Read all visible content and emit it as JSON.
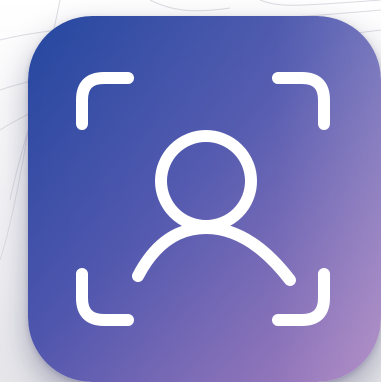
{
  "icon": {
    "name": "face-scan-app-icon",
    "symbol": "user-scan-icon",
    "gradient": {
      "top_left": "#2d4aa6",
      "mid": "#5a57b3",
      "bottom_right": "#9e73b9"
    },
    "stroke_color": "#ffffff"
  },
  "background": {
    "color": "#f4f4f6",
    "line_color": "#d8d8de"
  }
}
